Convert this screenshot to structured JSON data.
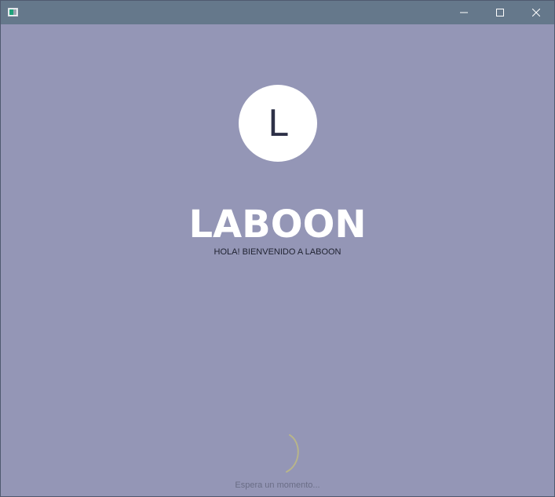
{
  "window": {
    "controls": {
      "minimize": "minimize-icon",
      "maximize": "maximize-icon",
      "close": "close-icon"
    }
  },
  "splash": {
    "avatar_letter": "L",
    "app_title": "LABOON",
    "welcome_message": "HOLA! BIENVENIDO A LABOON",
    "loading_text": "Espera un momento..."
  },
  "colors": {
    "background": "#9496b6",
    "titlebar": "#65788b",
    "avatar": "#ffffff",
    "spinner": "#b8b58a"
  }
}
